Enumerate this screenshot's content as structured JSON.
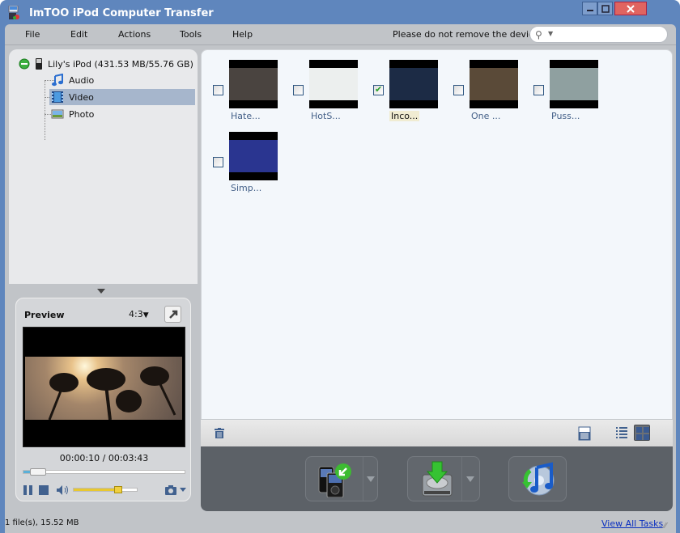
{
  "window": {
    "title": "ImTOO iPod Computer Transfer",
    "buttons": [
      "minimize",
      "maximize",
      "close"
    ]
  },
  "menubar": {
    "items": [
      "File",
      "Edit",
      "Actions",
      "Tools",
      "Help"
    ],
    "notice": "Please do not remove the device",
    "search": {
      "placeholder": "",
      "value": ""
    }
  },
  "tree": {
    "device": "Lily's iPod (431.53 MB/55.76 GB)",
    "items": [
      {
        "label": "Audio",
        "icon": "music-note-icon",
        "selected": false
      },
      {
        "label": "Video",
        "icon": "film-icon",
        "selected": true
      },
      {
        "label": "Photo",
        "icon": "picture-icon",
        "selected": false
      }
    ]
  },
  "preview": {
    "title": "Preview",
    "aspect_ratio": "4:3",
    "timecode": "00:00:10 / 00:03:43",
    "seek_progress": 0.045,
    "volume": 0.7
  },
  "videos": [
    {
      "label": "Hate...",
      "checked": false,
      "selected": false,
      "color": "#4a4440"
    },
    {
      "label": "HotS...",
      "checked": false,
      "selected": false,
      "color": "#ecefee"
    },
    {
      "label": "Inco...",
      "checked": true,
      "selected": true,
      "color": "#1c2b45"
    },
    {
      "label": "One ...",
      "checked": false,
      "selected": false,
      "color": "#5a4a38"
    },
    {
      "label": "Puss...",
      "checked": false,
      "selected": false,
      "color": "#8fa0a0"
    },
    {
      "label": "Simp...",
      "checked": false,
      "selected": false,
      "color": "#2a3590"
    }
  ],
  "toolbar": {
    "delete": "trash-icon",
    "view_options": [
      "details-icon",
      "list-icon",
      "grid-icon"
    ],
    "active_view": "grid"
  },
  "actions": [
    {
      "name": "device-to-device",
      "has_dropdown": true
    },
    {
      "name": "device-to-computer",
      "has_dropdown": true
    },
    {
      "name": "device-to-itunes",
      "has_dropdown": false
    }
  ],
  "status": {
    "summary": "1 file(s), 15.52 MB",
    "link": "View All Tasks"
  }
}
